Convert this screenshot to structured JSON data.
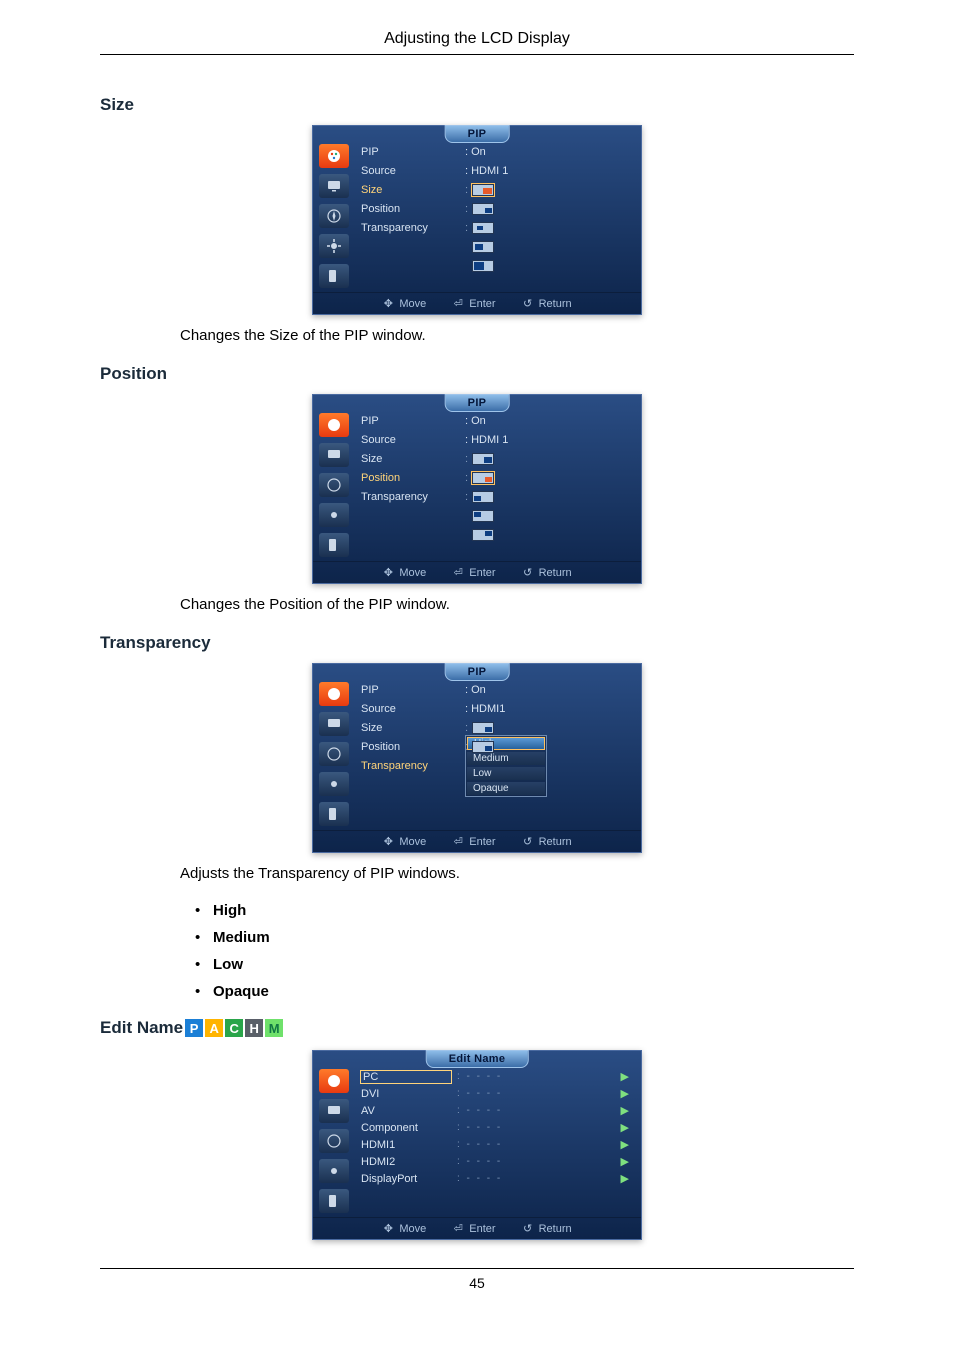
{
  "page": {
    "header": "Adjusting the LCD Display",
    "number": "45"
  },
  "sections": {
    "size": {
      "heading": "Size",
      "body": "Changes the Size of the PIP window."
    },
    "position": {
      "heading": "Position",
      "body": "Changes the Position of the PIP window."
    },
    "transparency": {
      "heading": "Transparency",
      "body": "Adjusts the Transparency of PIP windows.",
      "options": [
        "High",
        "Medium",
        "Low",
        "Opaque"
      ]
    },
    "editname": {
      "heading": "Edit Name",
      "badges": [
        "P",
        "A",
        "C",
        "H",
        "M"
      ]
    }
  },
  "osd_common": {
    "footer": {
      "move": "Move",
      "enter": "Enter",
      "return": "Return"
    }
  },
  "osd_size": {
    "title": "PIP",
    "rows": [
      {
        "label": "PIP",
        "value": ": On"
      },
      {
        "label": "Source",
        "value": ": HDMI 1"
      },
      {
        "label": "Size",
        "highlight": true
      },
      {
        "label": "Position"
      },
      {
        "label": "Transparency"
      }
    ]
  },
  "osd_position": {
    "title": "PIP",
    "rows": [
      {
        "label": "PIP",
        "value": ": On"
      },
      {
        "label": "Source",
        "value": ": HDMI 1"
      },
      {
        "label": "Size"
      },
      {
        "label": "Position",
        "highlight": true
      },
      {
        "label": "Transparency"
      }
    ]
  },
  "osd_transparency": {
    "title": "PIP",
    "rows": [
      {
        "label": "PIP",
        "value": ": On"
      },
      {
        "label": "Source",
        "value": ": HDMI1"
      },
      {
        "label": "Size"
      },
      {
        "label": "Position"
      },
      {
        "label": "Transparency",
        "highlight": true
      }
    ],
    "tray": [
      "High",
      "Medium",
      "Low",
      "Opaque"
    ]
  },
  "osd_editname": {
    "title": "Edit Name",
    "rows": [
      "PC",
      "DVI",
      "AV",
      "Component",
      "HDMI1",
      "HDMI2",
      "DisplayPort"
    ]
  }
}
